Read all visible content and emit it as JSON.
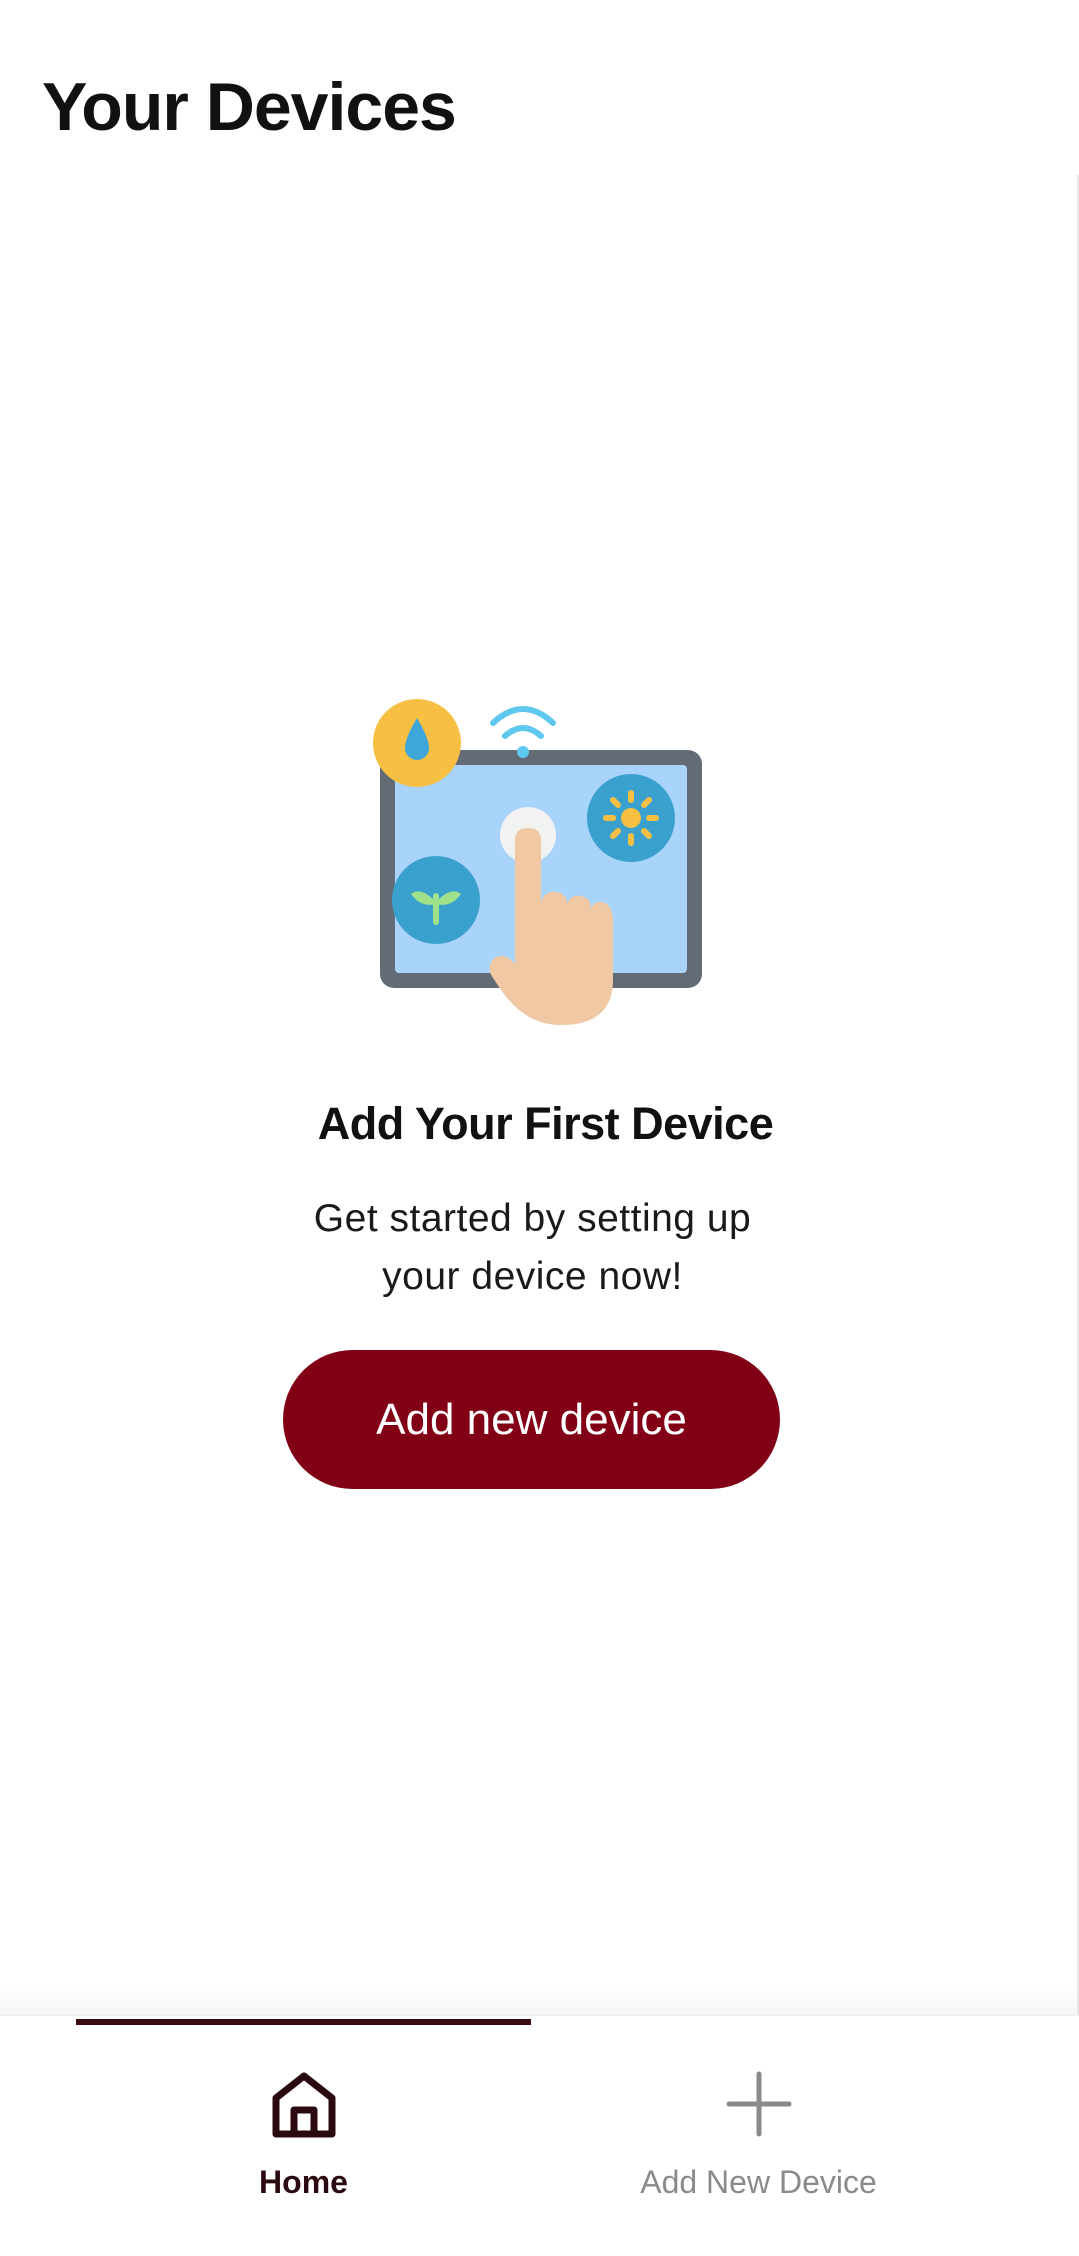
{
  "header": {
    "title": "Your Devices"
  },
  "empty_state": {
    "illustration": "tablet-touch-illustration",
    "title": "Add Your First Device",
    "description_line1": "Get started by setting up",
    "description_line2": "your device now!",
    "button_label": "Add new device",
    "button_color": "#820015"
  },
  "bottom_nav": {
    "items": [
      {
        "label": "Home",
        "icon": "home-icon",
        "active": true
      },
      {
        "label": "Add New Device",
        "icon": "plus-icon",
        "active": false
      }
    ],
    "active_color": "#3a0a10",
    "inactive_color": "#8a8a8a"
  }
}
